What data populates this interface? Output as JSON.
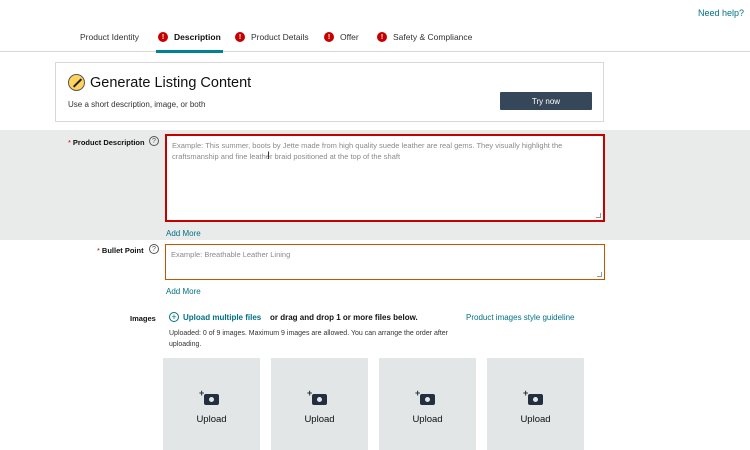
{
  "header": {
    "help_link": "Need help?"
  },
  "tabs": [
    {
      "label": "Product Identity",
      "error": false,
      "active": false
    },
    {
      "label": "Description",
      "error": true,
      "active": true
    },
    {
      "label": "Product Details",
      "error": true,
      "active": false
    },
    {
      "label": "Offer",
      "error": true,
      "active": false
    },
    {
      "label": "Safety & Compliance",
      "error": true,
      "active": false
    }
  ],
  "tab_error_glyph": "!",
  "generate": {
    "title": "Generate Listing Content",
    "subtitle": "Use a short description, image, or both",
    "button_label": "Try now",
    "icon": "magic-wand-icon"
  },
  "product_description": {
    "required_mark": "*",
    "label": "Product Description",
    "help_glyph": "?",
    "placeholder": "Example: This summer, boots by Jette made from high quality suede leather are real gems. They visually highlight the craftsmanship and fine leather braid positioned at the top of the shaft",
    "add_more": "Add More",
    "cursor_glyph": "I"
  },
  "bullet_point": {
    "required_mark": "*",
    "label": "Bullet Point",
    "help_glyph": "?",
    "placeholder": "Example: Breathable Leather Lining",
    "add_more": "Add More"
  },
  "images": {
    "label": "Images",
    "upload_multiple": "Upload multiple files",
    "plus_glyph": "+",
    "drag_text": "or drag and drop 1 or more files below.",
    "guideline_link": "Product images style guideline",
    "note": "Uploaded: 0 of 9 images. Maximum 9 images are allowed. You can arrange the order after uploading.",
    "tiles": [
      {
        "label": "Upload"
      },
      {
        "label": "Upload"
      },
      {
        "label": "Upload"
      },
      {
        "label": "Upload"
      }
    ]
  },
  "colors": {
    "accent_link": "#007185",
    "tab_active_underline": "#008296",
    "error_red": "#c40000",
    "button_dark": "#37475a",
    "description_row_bg": "#e9ebeb",
    "tile_bg": "#e3e6e6"
  }
}
